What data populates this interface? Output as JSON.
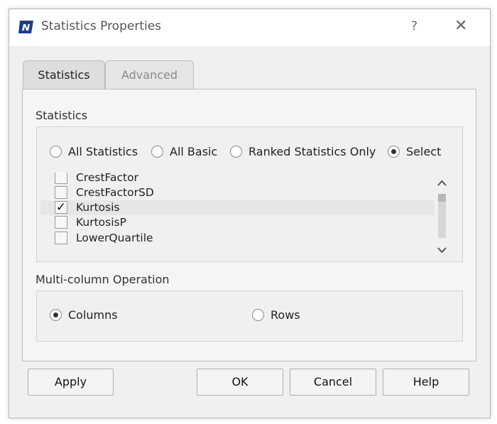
{
  "window": {
    "title": "Statistics Properties",
    "help_symbol": "?",
    "close_symbol": "✕"
  },
  "tabs": [
    {
      "label": "Statistics",
      "active": true
    },
    {
      "label": "Advanced",
      "active": false
    }
  ],
  "statistics": {
    "section_label": "Statistics",
    "radio_options": [
      {
        "label": "All Statistics",
        "selected": false
      },
      {
        "label": "All Basic",
        "selected": false
      },
      {
        "label": "Ranked Statistics Only",
        "selected": false
      },
      {
        "label": "Select",
        "selected": true
      }
    ],
    "list_items": [
      {
        "label": "CrestFactor",
        "checked": false
      },
      {
        "label": "CrestFactorSD",
        "checked": false
      },
      {
        "label": "Kurtosis",
        "checked": true
      },
      {
        "label": "KurtosisP",
        "checked": false
      },
      {
        "label": "LowerQuartile",
        "checked": false
      }
    ],
    "check_mark": "✓"
  },
  "multi_column": {
    "section_label": "Multi-column Operation",
    "options": [
      {
        "label": "Columns",
        "selected": true
      },
      {
        "label": "Rows",
        "selected": false
      }
    ]
  },
  "buttons": {
    "apply": "Apply",
    "ok": "OK",
    "cancel": "Cancel",
    "help": "Help"
  },
  "colors": {
    "accent": "#1a3d8f",
    "window_bg": "#f0f0f0"
  }
}
